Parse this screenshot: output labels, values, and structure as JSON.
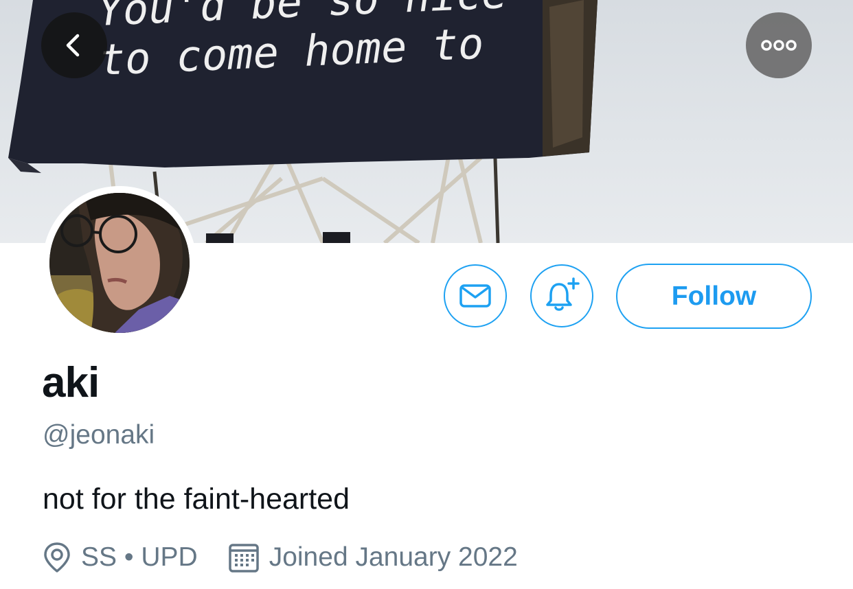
{
  "banner": {
    "billboard_line1": "You'd be so nice",
    "billboard_line2": "to come home to"
  },
  "header": {
    "back_icon": "chevron-left-icon",
    "more_icon": "ellipsis-icon"
  },
  "actions": {
    "message_icon": "envelope-icon",
    "notify_icon": "bell-plus-icon",
    "follow_label": "Follow",
    "accent_color": "#1da1f2"
  },
  "profile": {
    "name": "aki",
    "handle": "@jeonaki",
    "bio": "not for the faint-hearted",
    "location": "SS • UPD",
    "joined": "Joined January 2022"
  }
}
